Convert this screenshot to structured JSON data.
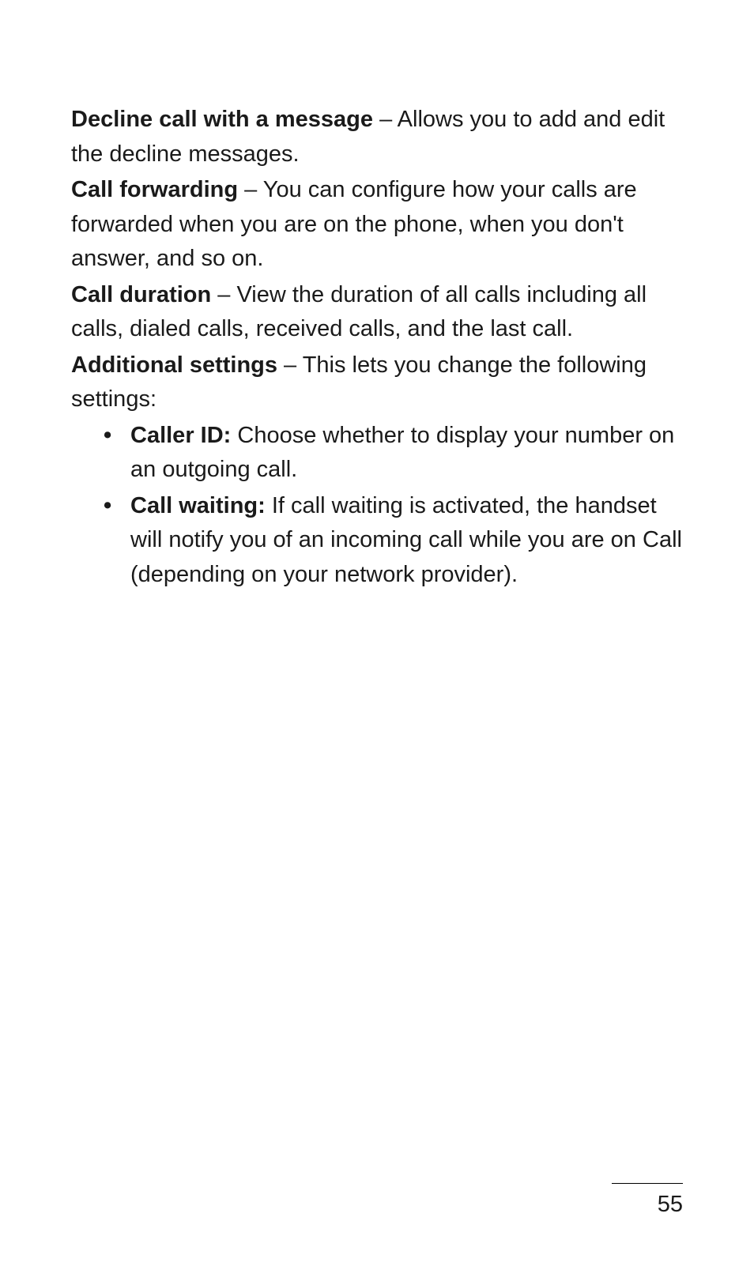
{
  "paragraphs": [
    {
      "bold": "Decline call with a message",
      "text": " – Allows you to add and edit the decline messages."
    },
    {
      "bold": "Call forwarding",
      "text": " – You can configure how your calls are forwarded when you are on the phone, when you don't answer, and so on."
    },
    {
      "bold": "Call duration",
      "text": " – View the duration of all calls including all calls, dialed calls, received calls, and the last call."
    },
    {
      "bold": "Additional settings",
      "text": " – This lets you change the following settings:"
    }
  ],
  "listItems": [
    {
      "bold": "Caller ID:",
      "text": " Choose whether to display your number on an outgoing call."
    },
    {
      "bold": "Call waiting:",
      "text": " If call waiting is activated, the handset will notify you of an incoming call while you are on Call (depending on your network provider)."
    }
  ],
  "pageNumber": "55"
}
